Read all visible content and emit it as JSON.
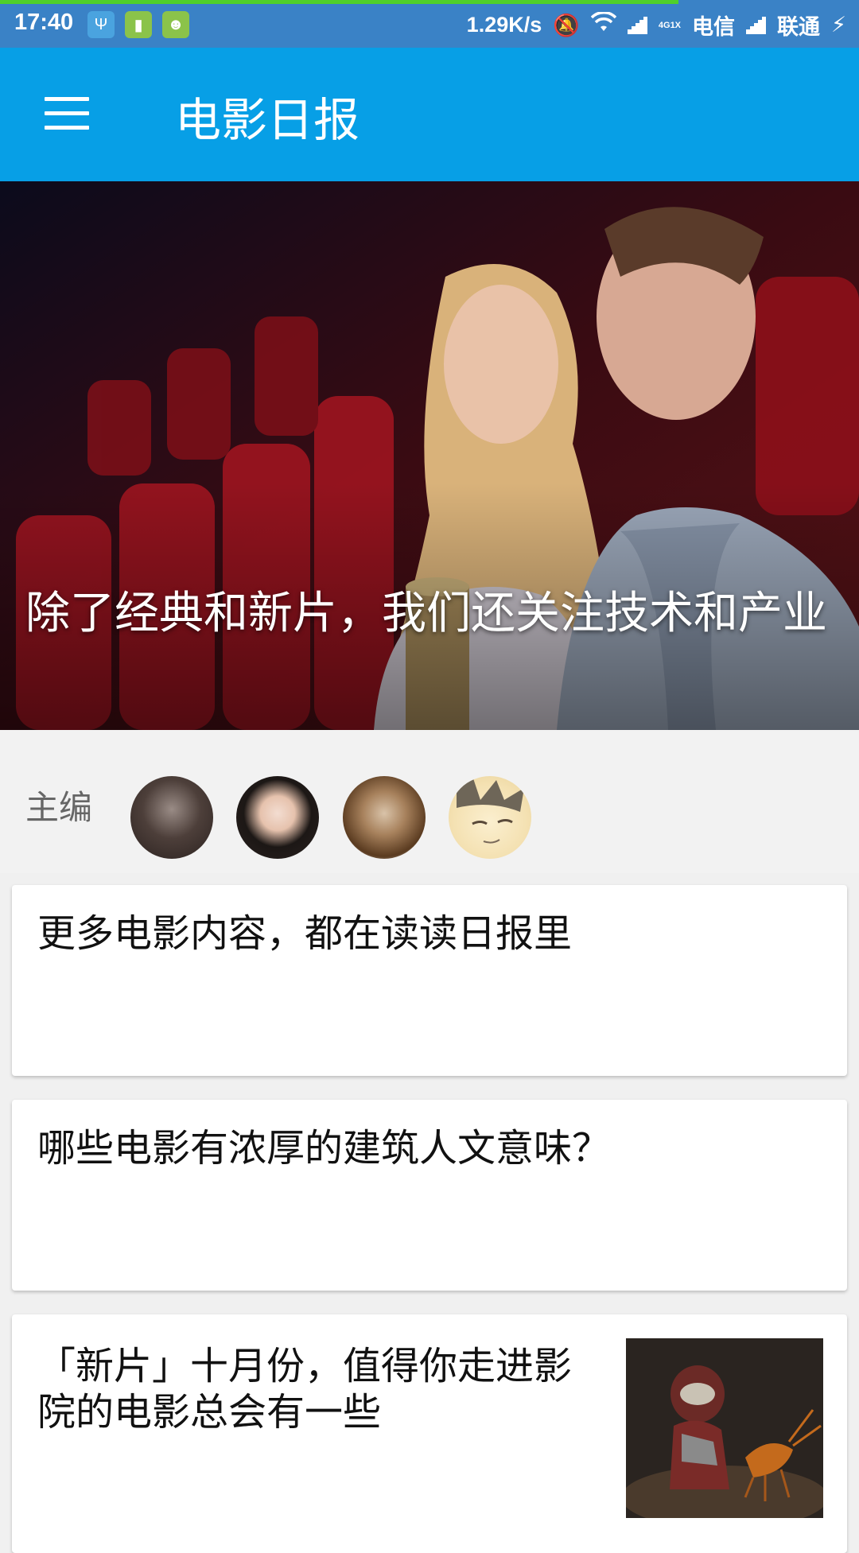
{
  "status_bar": {
    "time": "17:40",
    "network_speed": "1.29K/s",
    "signal_small_top": "4G",
    "signal_small_bottom": "1X",
    "carrier1": "电信",
    "carrier2": "联通",
    "loading_progress": 0.79
  },
  "app_bar": {
    "title": "电影日报",
    "color": "#079fe6"
  },
  "hero": {
    "caption": "除了经典和新片，我们还关注技术和产业"
  },
  "editors": {
    "label": "主编",
    "avatars": [
      "avatar-1",
      "avatar-2",
      "avatar-3",
      "avatar-4"
    ]
  },
  "stories": [
    {
      "title": "更多电影内容，都在读读日报里"
    },
    {
      "title": "哪些电影有浓厚的建筑人文意味？"
    },
    {
      "title": "「新片」十月份，值得你走进影院的电影总会有一些"
    }
  ]
}
